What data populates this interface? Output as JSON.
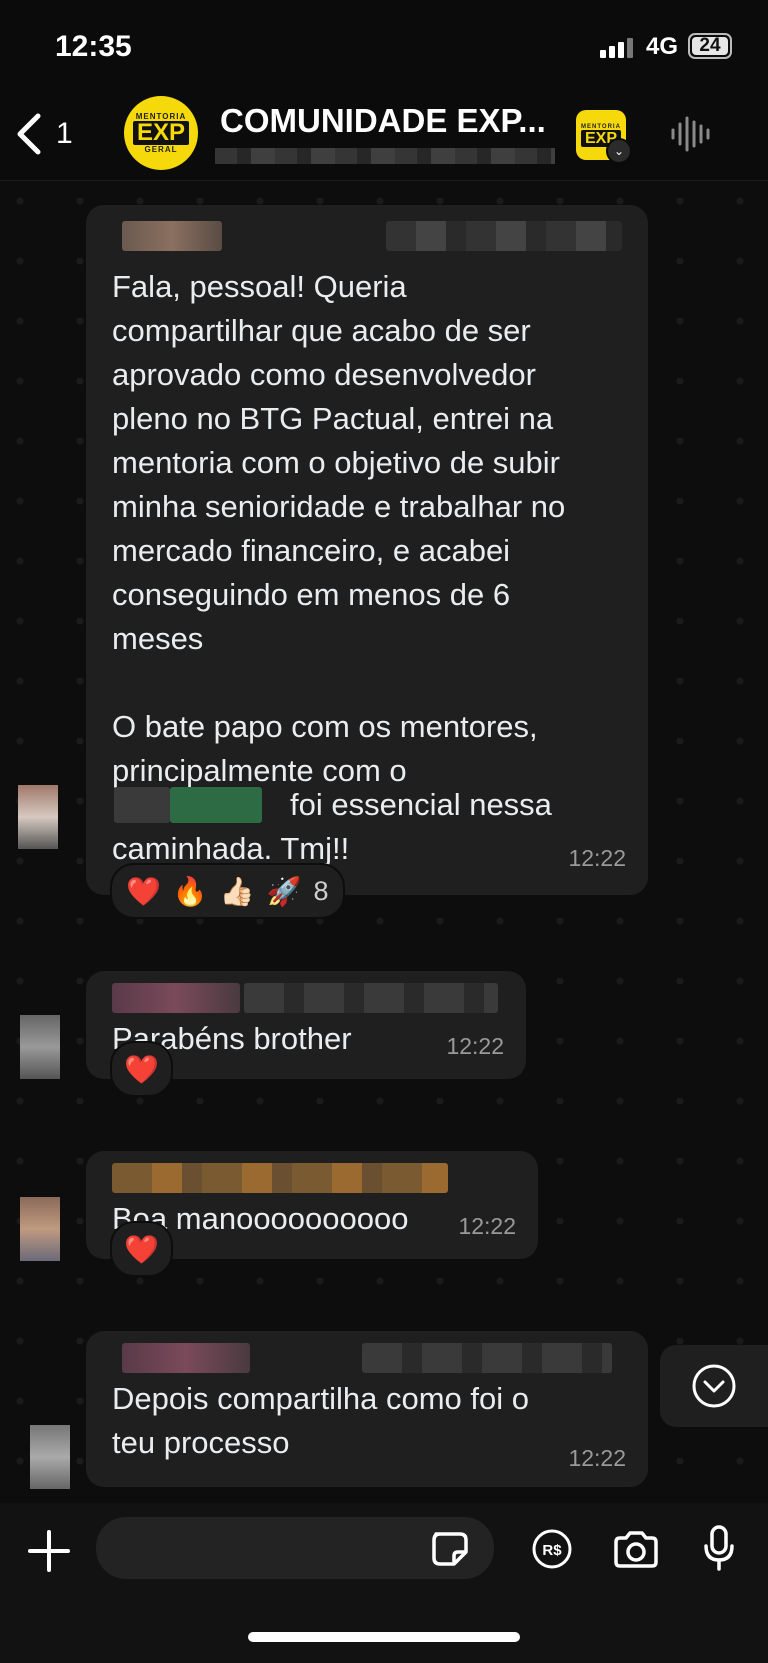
{
  "status_bar": {
    "time": "12:35",
    "network": "4G",
    "battery": "24"
  },
  "header": {
    "back_count": "1",
    "group_title": "COMUNIDADE EXP...",
    "logo_top": "MENTORIA",
    "logo_main": "EXP",
    "logo_bottom": "GERAL"
  },
  "messages": [
    {
      "text_1": "Fala, pessoal! Queria\ncompartilhar que acabo de ser\naprovado como desenvolvedor\npleno no BTG Pactual, entrei na\nmentoria com o objetivo de subir\nminha senioridade e trabalhar no\nmercado financeiro, e acabei\nconseguindo em menos de 6\nmeses",
      "text_2": "O bate papo com os mentores,\nprincipalmente com o",
      "text_3": "foi essencial nessa",
      "text_4": "caminhada. Tmj!!",
      "time": "12:22",
      "reactions": [
        "❤️",
        "🔥",
        "👍🏻",
        "🚀"
      ],
      "reaction_count": "8"
    },
    {
      "text": "Parabéns brother",
      "time": "12:22",
      "reactions": [
        "❤️"
      ]
    },
    {
      "text": "Boa manoooooooooo",
      "time": "12:22",
      "reactions": [
        "❤️"
      ]
    },
    {
      "text": "Depois compartilha como foi o\nteu processo",
      "time": "12:22"
    }
  ],
  "icons": {
    "back": "chevron-left-icon",
    "audio": "audio-waveform-icon",
    "scroll_down": "chevron-down-circle-icon",
    "plus": "plus-icon",
    "sticker": "sticker-icon",
    "payment": "brl-payment-icon",
    "camera": "camera-icon",
    "mic": "microphone-icon"
  },
  "colors": {
    "background": "#0b0b0b",
    "bubble": "#1f1f1f",
    "text": "#e9edef",
    "timestamp": "#9a9a9a",
    "brand_yellow": "#f5d90a",
    "blurred_mention": "#2d6b45"
  }
}
